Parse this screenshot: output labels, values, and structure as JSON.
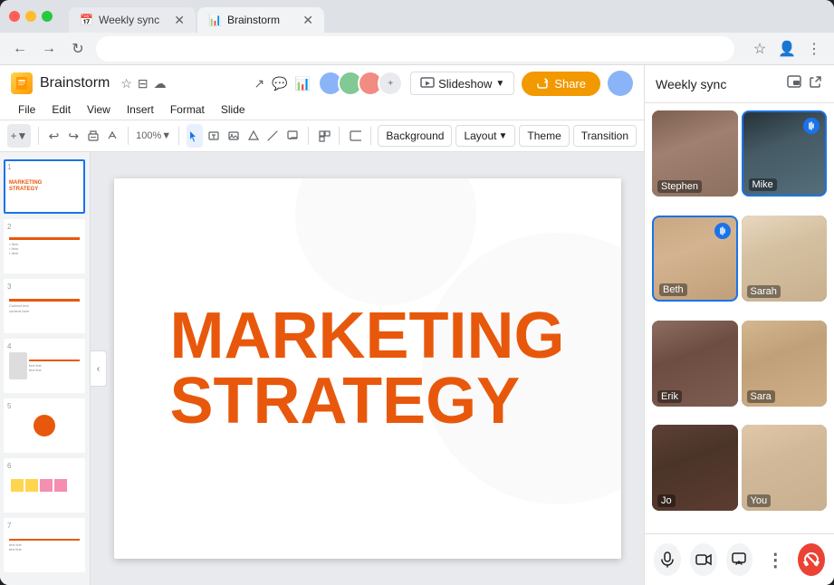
{
  "browser": {
    "tabs": [
      {
        "id": "tab-weeklysync",
        "title": "Weekly sync",
        "favicon": "📅",
        "active": false
      },
      {
        "id": "tab-brainstorm",
        "title": "Brainstorm",
        "favicon": "📊",
        "active": true
      }
    ],
    "address": ""
  },
  "slides_app": {
    "title": "Brainstorm",
    "menu_items": [
      "File",
      "Edit",
      "View",
      "Insert",
      "Format",
      "Slide"
    ],
    "toolbar_buttons": [
      {
        "icon": "+",
        "label": "add"
      },
      {
        "icon": "↩",
        "label": "undo"
      },
      {
        "icon": "↪",
        "label": "redo"
      },
      {
        "icon": "🖨",
        "label": "print"
      },
      {
        "icon": "✏",
        "label": "paint"
      },
      {
        "icon": "🔍",
        "label": "zoom"
      }
    ],
    "toolbar_actions": [
      "Background",
      "Layout",
      "Theme",
      "Transition"
    ],
    "slideshow_label": "Slideshow",
    "share_label": "Share",
    "main_slide": {
      "line1": "MARKETING",
      "line2": "STRATEGY"
    },
    "slide_count": 7
  },
  "meet": {
    "title": "Weekly sync",
    "participants": [
      {
        "id": "stephen",
        "name": "Stephen",
        "speaking": false,
        "face_class": "face-stephen"
      },
      {
        "id": "mike",
        "name": "Mike",
        "speaking": true,
        "face_class": "face-mike"
      },
      {
        "id": "beth",
        "name": "Beth",
        "speaking": true,
        "face_class": "face-beth"
      },
      {
        "id": "sarah",
        "name": "Sarah",
        "speaking": false,
        "face_class": "face-sarah"
      },
      {
        "id": "erik",
        "name": "Erik",
        "speaking": false,
        "face_class": "face-erik"
      },
      {
        "id": "sara",
        "name": "Sara",
        "speaking": false,
        "face_class": "face-sara"
      },
      {
        "id": "jo",
        "name": "Jo",
        "speaking": false,
        "face_class": "face-jo"
      },
      {
        "id": "you",
        "name": "You",
        "speaking": false,
        "face_class": "face-you"
      }
    ],
    "controls": {
      "mic": "mic",
      "camera": "camera",
      "present": "present",
      "more": "more",
      "end": "end"
    }
  },
  "colors": {
    "orange": "#e8580c",
    "blue": "#1a73e8",
    "red": "#ea4335",
    "share_bg": "#f29900",
    "speaking_border": "#1a73e8"
  }
}
